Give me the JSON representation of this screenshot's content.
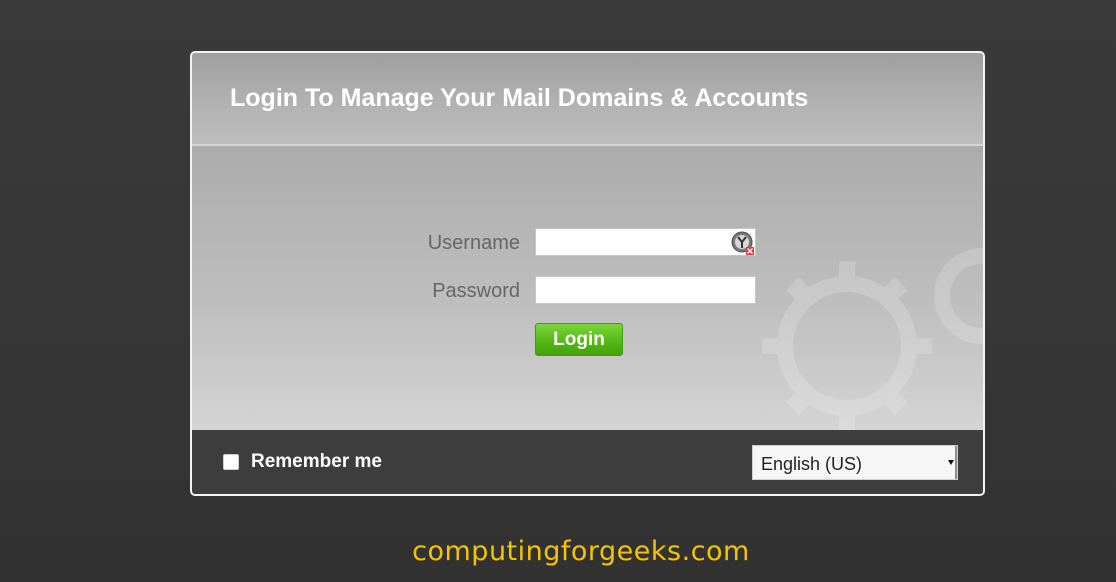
{
  "login_panel": {
    "title": "Login To Manage Your Mail Domains & Accounts",
    "username_label": "Username",
    "username_value": "",
    "password_label": "Password",
    "password_value": "",
    "login_button": "Login"
  },
  "footer": {
    "remember_me_label": "Remember me",
    "remember_me_checked": false,
    "language_selected": "English (US)"
  },
  "watermark": "computingforgeeks.com",
  "colors": {
    "login_button": "#55b916",
    "watermark": "#f5c400",
    "background": "#333333"
  }
}
